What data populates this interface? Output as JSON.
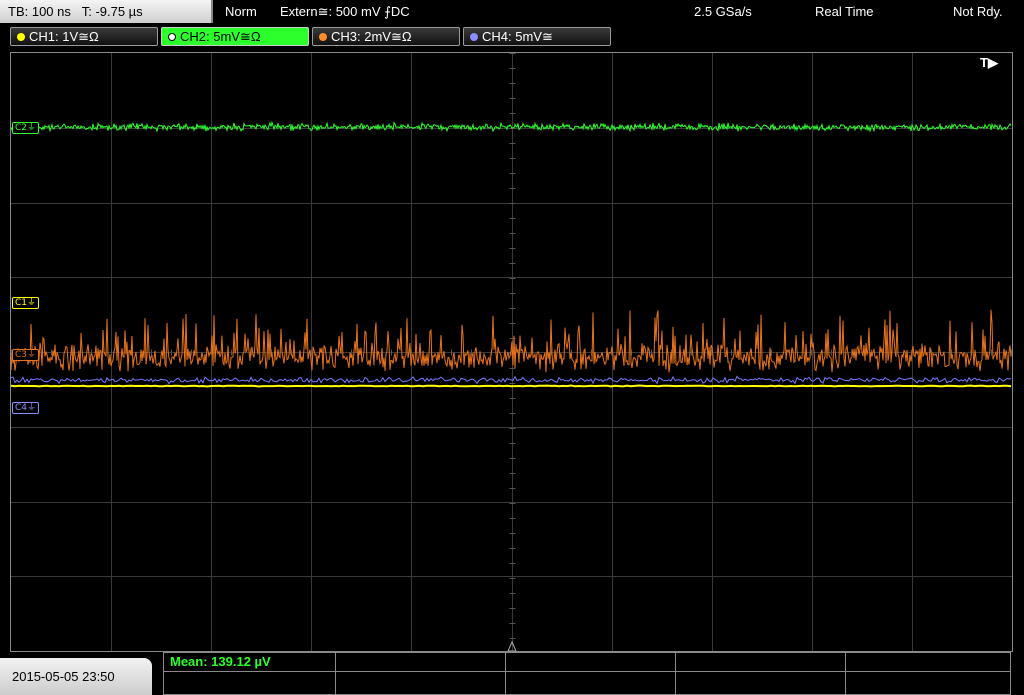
{
  "header": {
    "timebase": "TB: 100 ns",
    "trigger_time": "T: -9.75 µs",
    "trigger_mode": "Norm",
    "trigger_source": "Extern≅: 500 mV ⨍DC",
    "sample_rate": "2.5 GSa/s",
    "acq_mode": "Real Time",
    "status": "Not Rdy."
  },
  "channels": [
    {
      "label": "CH1: 1V≅Ω",
      "color": "#ffff00",
      "active": false
    },
    {
      "label": "CH2: 5mV≅Ω",
      "color": "#2cff2c",
      "active": true
    },
    {
      "label": "CH3: 2mV≅Ω",
      "color": "#ff8c2a",
      "active": false
    },
    {
      "label": "CH4: 5mV≅",
      "color": "#8c8cff",
      "active": false
    }
  ],
  "markers": {
    "c1": "C1⏚",
    "c2": "C2⏚",
    "c3": "C3⏚",
    "c4": "C4⏚",
    "trigger": "T▶"
  },
  "measurement": {
    "mean": "Mean: 139.12 µV"
  },
  "datetime": "2015-05-05 23:50",
  "colors": {
    "ch1": "#ffff00",
    "ch2": "#2cff2c",
    "ch3": "#e8731a",
    "ch4": "#7b7bff",
    "grid": "#3a3a3a"
  }
}
